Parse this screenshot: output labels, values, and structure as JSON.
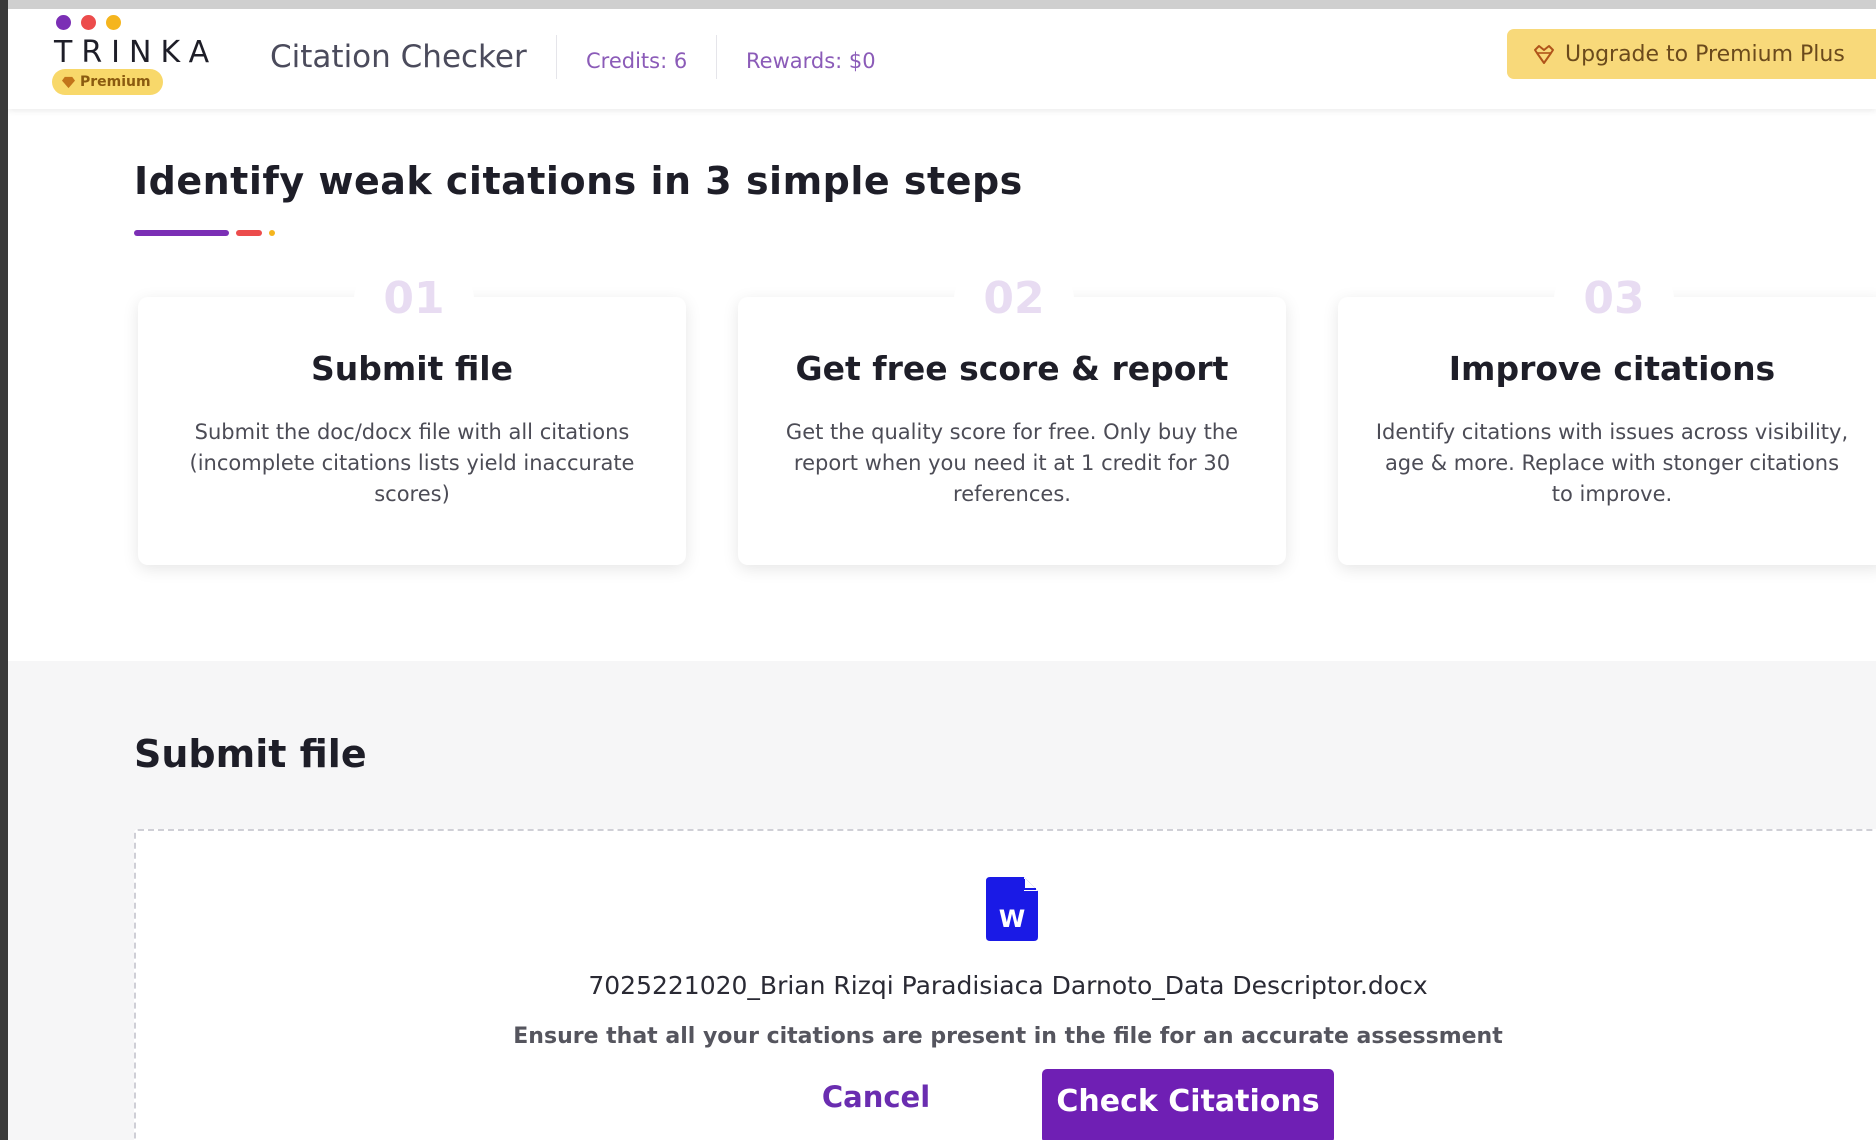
{
  "colors": {
    "brand_purple": "#6f1fb4",
    "dot_purple": "#7b2fb5",
    "dot_red": "#ec4c4c",
    "dot_yellow": "#f5b51e",
    "upgrade_bg": "#f8d97a",
    "stat_text": "#8b5bb8"
  },
  "header": {
    "logo_text": "TRINKA",
    "badge": "Premium",
    "app_title": "Citation Checker",
    "credits": "Credits: 6",
    "rewards": "Rewards: $0",
    "upgrade_label": "Upgrade to Premium Plus"
  },
  "steps_section": {
    "title": "Identify weak citations in 3 simple steps",
    "steps": [
      {
        "num": "01",
        "heading": "Submit file",
        "desc": "Submit the doc/docx file with all citations (incomplete citations lists yield inaccurate scores)"
      },
      {
        "num": "02",
        "heading": "Get free score & report",
        "desc": "Get the quality score for free. Only buy the report when you need it at 1 credit for 30 references."
      },
      {
        "num": "03",
        "heading": "Improve citations",
        "desc": "Identify citations with issues across visibility, age & more. Replace with stonger citations to improve."
      }
    ]
  },
  "submit_section": {
    "title": "Submit file",
    "file_icon": "word-doc-icon",
    "file_name": "7025221020_Brian Rizqi Paradisiaca Darnoto_Data Descriptor.docx",
    "hint": "Ensure that all your citations are present in the file for an accurate assessment",
    "cancel_label": "Cancel",
    "check_label": "Check Citations"
  }
}
